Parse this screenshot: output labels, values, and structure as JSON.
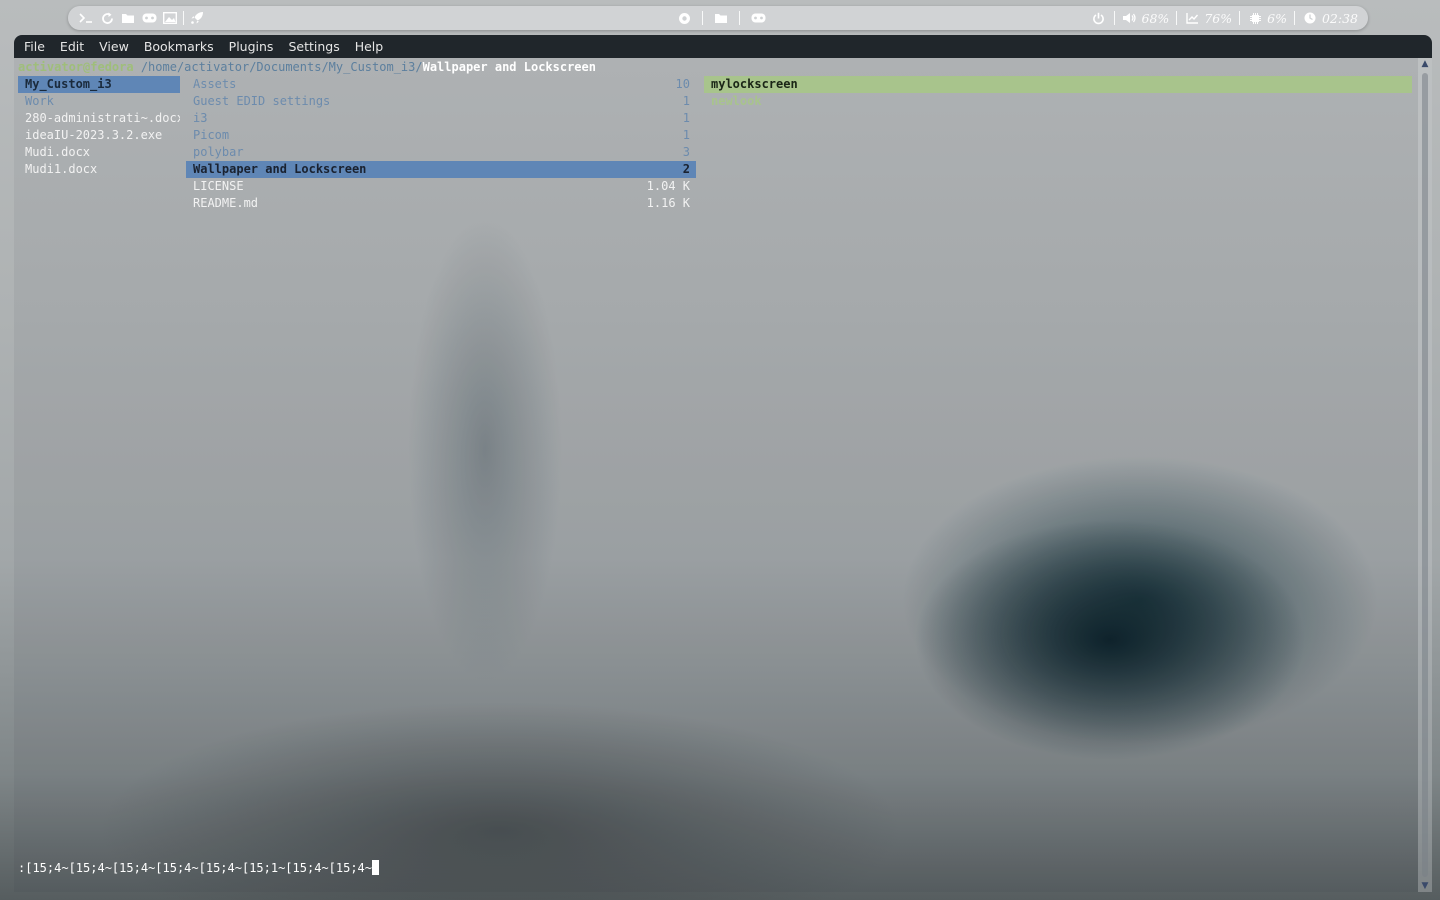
{
  "topbar": {
    "left_icons": [
      "terminal-icon",
      "refresh-icon",
      "folder-icon",
      "gamepad-icon",
      "image-icon",
      "rocket-icon"
    ],
    "center_icons": [
      "firefox-icon",
      "folder-icon",
      "gamepad-icon"
    ],
    "power_icon": "power-icon",
    "volume": "68%",
    "memory": "76%",
    "cpu": "6%",
    "clock": "02:38"
  },
  "menubar": {
    "items": [
      "File",
      "Edit",
      "View",
      "Bookmarks",
      "Plugins",
      "Settings",
      "Help"
    ]
  },
  "ranger": {
    "user_host": "activator@fedora",
    "path_dirs": "/home/activator/Documents/My_Custom_i3/",
    "current_dir": "Wallpaper and Lockscreen",
    "parent_column": [
      {
        "name": "My_Custom_i3",
        "type": "selected-dir"
      },
      {
        "name": "Work",
        "type": "dir"
      },
      {
        "name": "280-administrati~.docx",
        "type": "file"
      },
      {
        "name": "ideaIU-2023.3.2.exe",
        "type": "file"
      },
      {
        "name": "Mudi.docx",
        "type": "file"
      },
      {
        "name": "Mudi1.docx",
        "type": "file"
      }
    ],
    "current_column": [
      {
        "name": "Assets",
        "size": "10",
        "type": "dir"
      },
      {
        "name": "Guest EDID settings",
        "size": "1",
        "type": "dir"
      },
      {
        "name": "i3",
        "size": "1",
        "type": "dir"
      },
      {
        "name": "Picom",
        "size": "1",
        "type": "dir"
      },
      {
        "name": "polybar",
        "size": "3",
        "type": "dir"
      },
      {
        "name": "Wallpaper and Lockscreen",
        "size": "2",
        "type": "selected"
      },
      {
        "name": "LICENSE",
        "size": "1.04 K",
        "type": "file"
      },
      {
        "name": "README.md",
        "size": "1.16 K",
        "type": "file"
      }
    ],
    "preview_column": [
      {
        "name": "mylockscreen",
        "type": "selected-green"
      },
      {
        "name": "newlook",
        "type": "green"
      }
    ],
    "command_line": ":[15;4~[15;4~[15;4~[15;4~[15;4~[15;1~[15;4~[15;4~"
  },
  "colors": {
    "selection_blue": "#5f86b6",
    "selection_green": "#a8c48c",
    "user_host": "#9fbe7a",
    "menubar_bg": "#20262b"
  }
}
